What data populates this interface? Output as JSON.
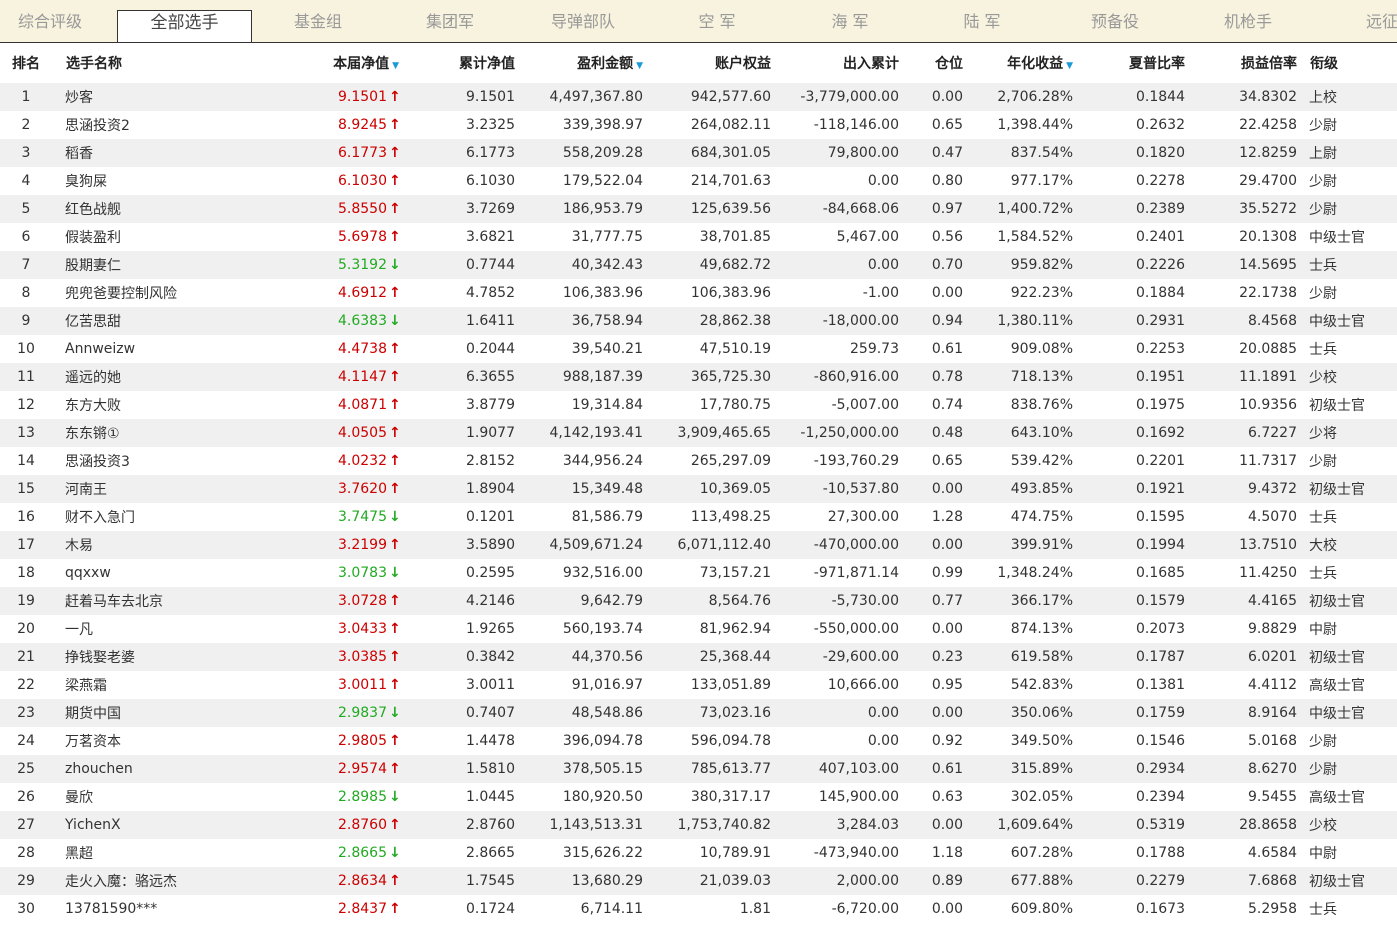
{
  "tabs": [
    "综合评级",
    "全部选手",
    "基金组",
    "集团军",
    "导弹部队",
    "空 军",
    "海 军",
    "陆 军",
    "预备役",
    "机枪手",
    "远征军"
  ],
  "active_tab": 1,
  "headers": {
    "rank": "排名",
    "name": "选手名称",
    "nav": "本届净值",
    "cum_nav": "累计净值",
    "profit": "盈利金额",
    "equity": "账户权益",
    "flow": "出入累计",
    "position": "仓位",
    "annual": "年化收益",
    "sharpe": "夏普比率",
    "pl_ratio": "损益倍率",
    "rank_title": "衔级"
  },
  "sorted_columns": [
    "nav",
    "profit",
    "annual"
  ],
  "colors": {
    "up": "#cc0000",
    "down": "#22aa22",
    "sort": "#1a9ad6",
    "tab_bg": "#f7f3de",
    "row_alt": "#f0f0f0"
  },
  "rows": [
    {
      "rank": "1",
      "name": "炒客",
      "nav": "9.1501",
      "dir": "up",
      "cum": "9.1501",
      "profit": "4,497,367.80",
      "equity": "942,577.60",
      "flow": "-3,779,000.00",
      "pos": "0.00",
      "annual": "2,706.28%",
      "sharpe": "0.1844",
      "pl": "34.8302",
      "title": "上校"
    },
    {
      "rank": "2",
      "name": "思涵投资2",
      "nav": "8.9245",
      "dir": "up",
      "cum": "3.2325",
      "profit": "339,398.97",
      "equity": "264,082.11",
      "flow": "-118,146.00",
      "pos": "0.65",
      "annual": "1,398.44%",
      "sharpe": "0.2632",
      "pl": "22.4258",
      "title": "少尉"
    },
    {
      "rank": "3",
      "name": "稻香",
      "nav": "6.1773",
      "dir": "up",
      "cum": "6.1773",
      "profit": "558,209.28",
      "equity": "684,301.05",
      "flow": "79,800.00",
      "pos": "0.47",
      "annual": "837.54%",
      "sharpe": "0.1820",
      "pl": "12.8259",
      "title": "上尉"
    },
    {
      "rank": "4",
      "name": "臭狗屎",
      "nav": "6.1030",
      "dir": "up",
      "cum": "6.1030",
      "profit": "179,522.04",
      "equity": "214,701.63",
      "flow": "0.00",
      "pos": "0.80",
      "annual": "977.17%",
      "sharpe": "0.2278",
      "pl": "29.4700",
      "title": "少尉"
    },
    {
      "rank": "5",
      "name": "红色战舰",
      "nav": "5.8550",
      "dir": "up",
      "cum": "3.7269",
      "profit": "186,953.79",
      "equity": "125,639.56",
      "flow": "-84,668.06",
      "pos": "0.97",
      "annual": "1,400.72%",
      "sharpe": "0.2389",
      "pl": "35.5272",
      "title": "少尉"
    },
    {
      "rank": "6",
      "name": "假装盈利",
      "nav": "5.6978",
      "dir": "up",
      "cum": "3.6821",
      "profit": "31,777.75",
      "equity": "38,701.85",
      "flow": "5,467.00",
      "pos": "0.56",
      "annual": "1,584.52%",
      "sharpe": "0.2401",
      "pl": "20.1308",
      "title": "中级士官"
    },
    {
      "rank": "7",
      "name": "股期妻仁",
      "nav": "5.3192",
      "dir": "down",
      "cum": "0.7744",
      "profit": "40,342.43",
      "equity": "49,682.72",
      "flow": "0.00",
      "pos": "0.70",
      "annual": "959.82%",
      "sharpe": "0.2226",
      "pl": "14.5695",
      "title": "士兵"
    },
    {
      "rank": "8",
      "name": "兜兜爸要控制风险",
      "nav": "4.6912",
      "dir": "up",
      "cum": "4.7852",
      "profit": "106,383.96",
      "equity": "106,383.96",
      "flow": "-1.00",
      "pos": "0.00",
      "annual": "922.23%",
      "sharpe": "0.1884",
      "pl": "22.1738",
      "title": "少尉"
    },
    {
      "rank": "9",
      "name": "亿苦思甜",
      "nav": "4.6383",
      "dir": "down",
      "cum": "1.6411",
      "profit": "36,758.94",
      "equity": "28,862.38",
      "flow": "-18,000.00",
      "pos": "0.94",
      "annual": "1,380.11%",
      "sharpe": "0.2931",
      "pl": "8.4568",
      "title": "中级士官"
    },
    {
      "rank": "10",
      "name": "Annweizw",
      "nav": "4.4738",
      "dir": "up",
      "cum": "0.2044",
      "profit": "39,540.21",
      "equity": "47,510.19",
      "flow": "259.73",
      "pos": "0.61",
      "annual": "909.08%",
      "sharpe": "0.2253",
      "pl": "20.0885",
      "title": "士兵"
    },
    {
      "rank": "11",
      "name": "遥远的她",
      "nav": "4.1147",
      "dir": "up",
      "cum": "6.3655",
      "profit": "988,187.39",
      "equity": "365,725.30",
      "flow": "-860,916.00",
      "pos": "0.78",
      "annual": "718.13%",
      "sharpe": "0.1951",
      "pl": "11.1891",
      "title": "少校"
    },
    {
      "rank": "12",
      "name": "东方大败",
      "nav": "4.0871",
      "dir": "up",
      "cum": "3.8779",
      "profit": "19,314.84",
      "equity": "17,780.75",
      "flow": "-5,007.00",
      "pos": "0.74",
      "annual": "838.76%",
      "sharpe": "0.1975",
      "pl": "10.9356",
      "title": "初级士官"
    },
    {
      "rank": "13",
      "name": "东东锵①",
      "nav": "4.0505",
      "dir": "up",
      "cum": "1.9077",
      "profit": "4,142,193.41",
      "equity": "3,909,465.65",
      "flow": "-1,250,000.00",
      "pos": "0.48",
      "annual": "643.10%",
      "sharpe": "0.1692",
      "pl": "6.7227",
      "title": "少将"
    },
    {
      "rank": "14",
      "name": "思涵投资3",
      "nav": "4.0232",
      "dir": "up",
      "cum": "2.8152",
      "profit": "344,956.24",
      "equity": "265,297.09",
      "flow": "-193,760.29",
      "pos": "0.65",
      "annual": "539.42%",
      "sharpe": "0.2201",
      "pl": "11.7317",
      "title": "少尉"
    },
    {
      "rank": "15",
      "name": "河南王",
      "nav": "3.7620",
      "dir": "up",
      "cum": "1.8904",
      "profit": "15,349.48",
      "equity": "10,369.05",
      "flow": "-10,537.80",
      "pos": "0.00",
      "annual": "493.85%",
      "sharpe": "0.1921",
      "pl": "9.4372",
      "title": "初级士官"
    },
    {
      "rank": "16",
      "name": "财不入急门",
      "nav": "3.7475",
      "dir": "down",
      "cum": "0.1201",
      "profit": "81,586.79",
      "equity": "113,498.25",
      "flow": "27,300.00",
      "pos": "1.28",
      "annual": "474.75%",
      "sharpe": "0.1595",
      "pl": "4.5070",
      "title": "士兵"
    },
    {
      "rank": "17",
      "name": "木易",
      "nav": "3.2199",
      "dir": "up",
      "cum": "3.5890",
      "profit": "4,509,671.24",
      "equity": "6,071,112.40",
      "flow": "-470,000.00",
      "pos": "0.00",
      "annual": "399.91%",
      "sharpe": "0.1994",
      "pl": "13.7510",
      "title": "大校"
    },
    {
      "rank": "18",
      "name": "qqxxw",
      "nav": "3.0783",
      "dir": "down",
      "cum": "0.2595",
      "profit": "932,516.00",
      "equity": "73,157.21",
      "flow": "-971,871.14",
      "pos": "0.99",
      "annual": "1,348.24%",
      "sharpe": "0.1685",
      "pl": "11.4250",
      "title": "士兵"
    },
    {
      "rank": "19",
      "name": "赶着马车去北京",
      "nav": "3.0728",
      "dir": "up",
      "cum": "4.2146",
      "profit": "9,642.79",
      "equity": "8,564.76",
      "flow": "-5,730.00",
      "pos": "0.77",
      "annual": "366.17%",
      "sharpe": "0.1579",
      "pl": "4.4165",
      "title": "初级士官"
    },
    {
      "rank": "20",
      "name": "一凡",
      "nav": "3.0433",
      "dir": "up",
      "cum": "1.9265",
      "profit": "560,193.74",
      "equity": "81,962.94",
      "flow": "-550,000.00",
      "pos": "0.00",
      "annual": "874.13%",
      "sharpe": "0.2073",
      "pl": "9.8829",
      "title": "中尉"
    },
    {
      "rank": "21",
      "name": "挣钱娶老婆",
      "nav": "3.0385",
      "dir": "up",
      "cum": "0.3842",
      "profit": "44,370.56",
      "equity": "25,368.44",
      "flow": "-29,600.00",
      "pos": "0.23",
      "annual": "619.58%",
      "sharpe": "0.1787",
      "pl": "6.0201",
      "title": "初级士官"
    },
    {
      "rank": "22",
      "name": "梁燕霜",
      "nav": "3.0011",
      "dir": "up",
      "cum": "3.0011",
      "profit": "91,016.97",
      "equity": "133,051.89",
      "flow": "10,666.00",
      "pos": "0.95",
      "annual": "542.83%",
      "sharpe": "0.1381",
      "pl": "4.4112",
      "title": "高级士官"
    },
    {
      "rank": "23",
      "name": "期货中国",
      "nav": "2.9837",
      "dir": "down",
      "cum": "0.7407",
      "profit": "48,548.86",
      "equity": "73,023.16",
      "flow": "0.00",
      "pos": "0.00",
      "annual": "350.06%",
      "sharpe": "0.1759",
      "pl": "8.9164",
      "title": "中级士官"
    },
    {
      "rank": "24",
      "name": "万茗资本",
      "nav": "2.9805",
      "dir": "up",
      "cum": "1.4478",
      "profit": "396,094.78",
      "equity": "596,094.78",
      "flow": "0.00",
      "pos": "0.92",
      "annual": "349.50%",
      "sharpe": "0.1546",
      "pl": "5.0168",
      "title": "少尉"
    },
    {
      "rank": "25",
      "name": "zhouchen",
      "nav": "2.9574",
      "dir": "up",
      "cum": "1.5810",
      "profit": "378,505.15",
      "equity": "785,613.77",
      "flow": "407,103.00",
      "pos": "0.61",
      "annual": "315.89%",
      "sharpe": "0.2934",
      "pl": "8.6270",
      "title": "少尉"
    },
    {
      "rank": "26",
      "name": "曼欣",
      "nav": "2.8985",
      "dir": "down",
      "cum": "1.0445",
      "profit": "180,920.50",
      "equity": "380,317.17",
      "flow": "145,900.00",
      "pos": "0.63",
      "annual": "302.05%",
      "sharpe": "0.2394",
      "pl": "9.5455",
      "title": "高级士官"
    },
    {
      "rank": "27",
      "name": "YichenX",
      "nav": "2.8760",
      "dir": "up",
      "cum": "2.8760",
      "profit": "1,143,513.31",
      "equity": "1,753,740.82",
      "flow": "3,284.03",
      "pos": "0.00",
      "annual": "1,609.64%",
      "sharpe": "0.5319",
      "pl": "28.8658",
      "title": "少校"
    },
    {
      "rank": "28",
      "name": "黑超",
      "nav": "2.8665",
      "dir": "down",
      "cum": "2.8665",
      "profit": "315,626.22",
      "equity": "10,789.91",
      "flow": "-473,940.00",
      "pos": "1.18",
      "annual": "607.28%",
      "sharpe": "0.1788",
      "pl": "4.6584",
      "title": "中尉"
    },
    {
      "rank": "29",
      "name": "走火入魔：骆远杰",
      "nav": "2.8634",
      "dir": "up",
      "cum": "1.7545",
      "profit": "13,680.29",
      "equity": "21,039.03",
      "flow": "2,000.00",
      "pos": "0.89",
      "annual": "677.88%",
      "sharpe": "0.2279",
      "pl": "7.6868",
      "title": "初级士官"
    },
    {
      "rank": "30",
      "name": "13781590***",
      "nav": "2.8437",
      "dir": "up",
      "cum": "0.1724",
      "profit": "6,714.11",
      "equity": "1.81",
      "flow": "-6,720.00",
      "pos": "0.00",
      "annual": "609.80%",
      "sharpe": "0.1673",
      "pl": "5.2958",
      "title": "士兵"
    }
  ]
}
